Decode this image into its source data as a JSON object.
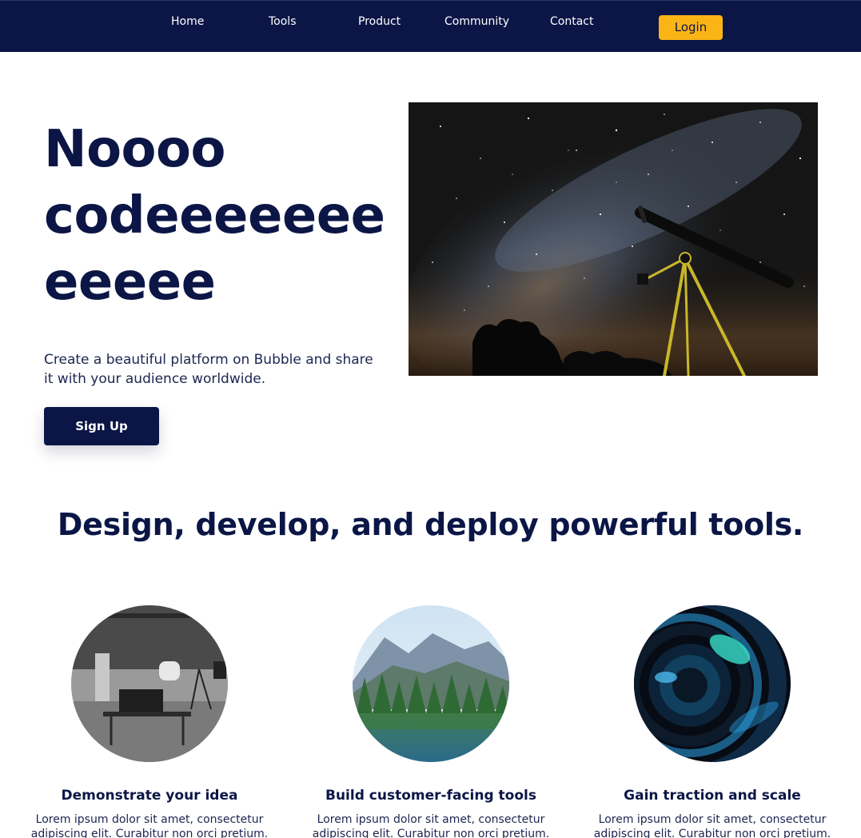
{
  "nav": {
    "links": [
      "Home",
      "Tools",
      "Product",
      "Community",
      "Contact"
    ],
    "login_label": "Login"
  },
  "hero": {
    "title_line1": "Noooo",
    "title_line2": "codeeeeeee",
    "title_line3": "eeeee",
    "subtitle": "Create a beautiful platform on Bubble and share it with your audience worldwide.",
    "cta_label": "Sign Up"
  },
  "section": {
    "heading": "Design, develop, and deploy powerful tools."
  },
  "features": [
    {
      "title": "Demonstrate your idea",
      "text": "Lorem ipsum dolor sit amet, consectetur adipiscing elit. Curabitur non orci pretium."
    },
    {
      "title": "Build customer-facing tools",
      "text": "Lorem ipsum dolor sit amet, consectetur adipiscing elit. Curabitur non orci pretium."
    },
    {
      "title": "Gain traction and scale",
      "text": "Lorem ipsum dolor sit amet, consectetur adipiscing elit. Curabitur non orci pretium."
    }
  ],
  "colors": {
    "navy": "#0b1646",
    "accent": "#fbb416",
    "white": "#ffffff"
  }
}
